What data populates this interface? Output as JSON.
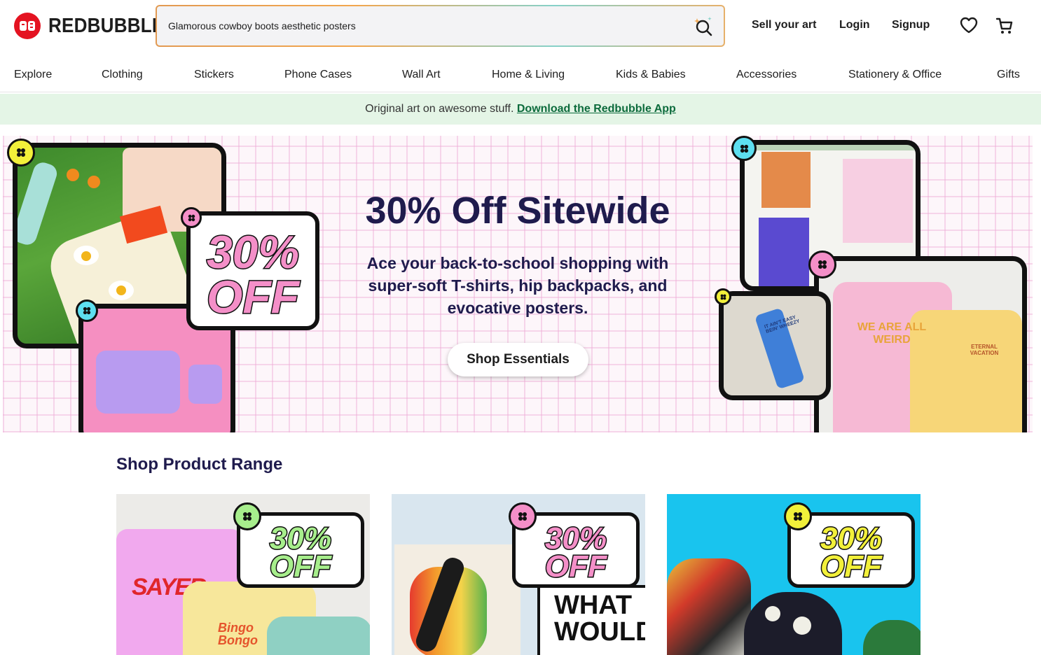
{
  "header": {
    "logo_text": "REDBUBBLE",
    "search_value": "Glamorous cowboy boots aesthetic posters",
    "links": [
      "Sell your art",
      "Login",
      "Signup"
    ]
  },
  "nav": {
    "categories": [
      "Explore",
      "Clothing",
      "Stickers",
      "Phone Cases",
      "Wall Art",
      "Home & Living",
      "Kids & Babies",
      "Accessories",
      "Stationery & Office",
      "Gifts"
    ]
  },
  "strip": {
    "text": "Original art on awesome stuff.",
    "link": "Download the Redbubble App"
  },
  "hero": {
    "title": "30% Off Sitewide",
    "subtitle": "Ace your back-to-school shopping with super-soft T-shirts, hip backpacks, and evocative posters.",
    "button": "Shop Essentials",
    "badge_line1": "30%",
    "badge_line2": "OFF"
  },
  "section": {
    "title": "Shop Product Range",
    "cards": [
      {
        "badge_line1": "30%",
        "badge_line2": "OFF",
        "art_text": "SAYER",
        "art_text2": "Bingo Bongo"
      },
      {
        "badge_line1": "30%",
        "badge_line2": "OFF",
        "art_text": "WHAT WOULD"
      },
      {
        "badge_line1": "30%",
        "badge_line2": "OFF"
      }
    ]
  },
  "hero_art": {
    "sticker_text": "IT AIN'T EASY BEIN' WHEEZY",
    "tee_text": "WE ARE ALL WEIRD",
    "tee2_text": "ETERNAL VACATION"
  },
  "colors": {
    "brand_red": "#e41321",
    "navy": "#1f1b4d",
    "strip_bg": "#e4f5e6",
    "badge_pink": "#f48fc8",
    "badge_green": "#a7ee8c",
    "badge_yellow": "#f2f03a"
  }
}
